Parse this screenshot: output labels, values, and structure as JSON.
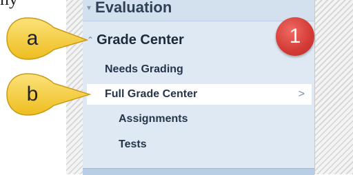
{
  "top_text": "ny",
  "menu": {
    "section_label": "Evaluation",
    "group_label": "Grade Center",
    "items": {
      "needs_grading": "Needs Grading",
      "full_grade_center": "Full Grade Center",
      "assignments": "Assignments",
      "tests": "Tests"
    },
    "arrow": ">"
  },
  "callouts": {
    "a": "a",
    "b": "b"
  },
  "badge": "1",
  "colors": {
    "callout_fill": "#f5cf3a",
    "badge_fill": "#d33a35",
    "panel_bg": "#dfe9f4"
  }
}
